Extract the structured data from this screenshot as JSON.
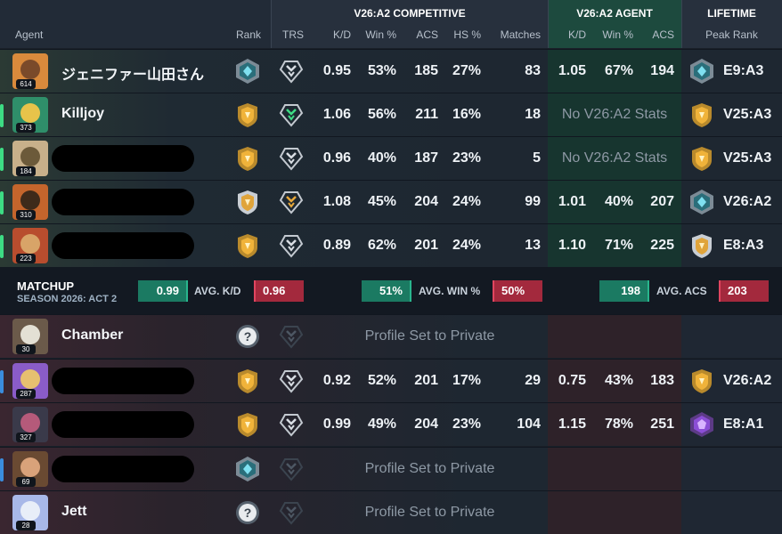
{
  "headers": {
    "comp_group": "V26:A2 COMPETITIVE",
    "agent_group": "V26:A2 AGENT",
    "lifetime_group": "LIFETIME",
    "agent": "Agent",
    "rank": "Rank",
    "trs": "TRS",
    "kd": "K/D",
    "win": "Win %",
    "acs": "ACS",
    "hs": "HS %",
    "matches": "Matches",
    "agent_kd": "K/D",
    "agent_win": "Win %",
    "agent_acs": "ACS",
    "peak_rank": "Peak Rank"
  },
  "colors": {
    "team_a_accent": "#3ddc84",
    "team_b_accent": "#3a8dde",
    "positive": "#1b7a62",
    "negative": "#a3293d"
  },
  "team_a": [
    {
      "name": "ジェニファー山田さん",
      "level": "614",
      "rank_icon": "ascendant-icon",
      "trs_icon": "trs-silver-icon",
      "kd": "0.95",
      "win": "53%",
      "acs": "185",
      "hs": "27%",
      "matches": "83",
      "agent_kd": "1.05",
      "agent_win": "67%",
      "agent_acs": "194",
      "peak": "E9:A3",
      "peak_icon": "ascendant-icon"
    },
    {
      "name": "Killjoy",
      "level": "373",
      "rank_icon": "gold-icon",
      "trs_icon": "trs-green-icon",
      "kd": "1.06",
      "win": "56%",
      "acs": "211",
      "hs": "16%",
      "matches": "18",
      "agent_note": "No V26:A2 Stats",
      "peak": "V25:A3",
      "peak_icon": "gold-icon"
    },
    {
      "name": "",
      "level": "184",
      "rank_icon": "gold-icon",
      "trs_icon": "trs-silver-icon",
      "kd": "0.96",
      "win": "40%",
      "acs": "187",
      "hs": "23%",
      "matches": "5",
      "agent_note": "No V26:A2 Stats",
      "peak": "V25:A3",
      "peak_icon": "gold-icon"
    },
    {
      "name": "",
      "level": "310",
      "rank_icon": "gold-silver-icon",
      "trs_icon": "trs-gold-icon",
      "kd": "1.08",
      "win": "45%",
      "acs": "204",
      "hs": "24%",
      "matches": "99",
      "agent_kd": "1.01",
      "agent_win": "40%",
      "agent_acs": "207",
      "peak": "V26:A2",
      "peak_icon": "ascendant-icon"
    },
    {
      "name": "",
      "level": "223",
      "rank_icon": "gold-icon",
      "trs_icon": "trs-silver-icon",
      "kd": "0.89",
      "win": "62%",
      "acs": "201",
      "hs": "24%",
      "matches": "13",
      "agent_kd": "1.10",
      "agent_win": "71%",
      "agent_acs": "225",
      "peak": "E8:A3",
      "peak_icon": "gold-silver-icon"
    }
  ],
  "matchup": {
    "title": "MATCHUP",
    "season": "SEASON 2026: ACT 2",
    "kd_label": "AVG. K/D",
    "kd_a": "0.99",
    "kd_b": "0.96",
    "win_label": "AVG. WIN %",
    "win_a": "51%",
    "win_b": "50%",
    "acs_label": "AVG. ACS",
    "acs_a": "198",
    "acs_b": "203"
  },
  "team_b": [
    {
      "name": "Chamber",
      "level": "30",
      "rank_icon": "unknown-rank-icon",
      "trs_icon": "trs-dim-icon",
      "private_text": "Profile Set to Private"
    },
    {
      "name": "",
      "level": "287",
      "rank_icon": "gold-icon",
      "trs_icon": "trs-silver-icon",
      "kd": "0.92",
      "win": "52%",
      "acs": "201",
      "hs": "17%",
      "matches": "29",
      "agent_kd": "0.75",
      "agent_win": "43%",
      "agent_acs": "183",
      "peak": "V26:A2",
      "peak_icon": "gold-icon"
    },
    {
      "name": "",
      "level": "327",
      "rank_icon": "gold-icon",
      "trs_icon": "trs-silver-icon",
      "kd": "0.99",
      "win": "49%",
      "acs": "204",
      "hs": "23%",
      "matches": "104",
      "agent_kd": "1.15",
      "agent_win": "78%",
      "agent_acs": "251",
      "peak": "E8:A1",
      "peak_icon": "immortal-icon"
    },
    {
      "name": "",
      "level": "69",
      "rank_icon": "ascendant-icon",
      "trs_icon": "trs-dim-icon",
      "private_text": "Profile Set to Private"
    },
    {
      "name": "Jett",
      "level": "28",
      "rank_icon": "unknown-rank-icon",
      "trs_icon": "trs-dim-icon",
      "private_text": "Profile Set to Private"
    }
  ]
}
